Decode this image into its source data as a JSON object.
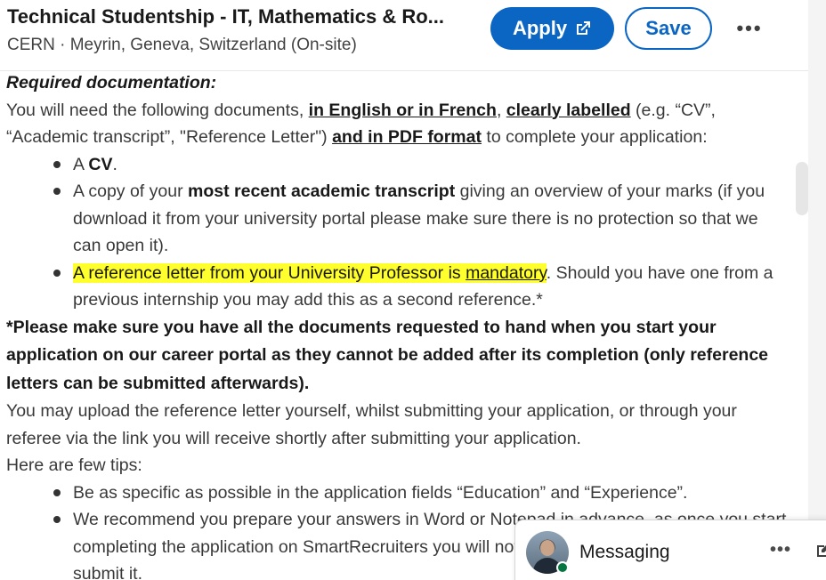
{
  "header": {
    "job_title": "Technical Studentship - IT, Mathematics & Ro...",
    "job_subtitle": "CERN · Meyrin, Geneva, Switzerland (On-site)",
    "apply_label": "Apply",
    "save_label": "Save",
    "more_label": "•••"
  },
  "content": {
    "heading": "Required documentation:",
    "intro": {
      "t1": "You will need the following documents, ",
      "u1": "in English or in French",
      "t2": ", ",
      "u2": "clearly labelled",
      "t3": " (e.g. “CV”, “Academic transcript”, \"Reference Letter\") ",
      "u3": "and in PDF format",
      "t4": " to complete your application:"
    },
    "docs": {
      "item1_pre": "A ",
      "item1_bold": "CV",
      "item1_post": ".",
      "item2_pre": "A copy of your ",
      "item2_bold": "most recent academic transcript",
      "item2_post": " giving an overview of your marks (if you download it from your university portal please make sure there is no protection so that we can open it).",
      "item3_hl": "A reference letter from your University Professor is ",
      "item3_hl_u": "mandatory",
      "item3_post": ". Should you have one from a previous internship you may add this as a second reference.*"
    },
    "notice": "*Please make sure you have all the documents requested to hand when you start your application on our career portal as they cannot be added after its completion (only reference letters can be submitted afterwards).",
    "upload_text": "You may upload the reference letter yourself, whilst submitting your application, or through your referee via the link you will receive shortly after submitting your application.",
    "tips_heading": "Here are few tips:",
    "tips": {
      "tip1": "Be as specific as possible in the application fields “Education” and “Experience”.",
      "tip2": "We recommend you prepare your answers in Word or Notepad in advance, as once you start completing the application on SmartRecruiters you will not be able to save and return later to submit it."
    }
  },
  "messaging": {
    "label": "Messaging",
    "more_label": "•••",
    "online_status_color": "#057642"
  },
  "colors": {
    "accent": "#0a66c2",
    "highlight": "#ffff2e"
  }
}
